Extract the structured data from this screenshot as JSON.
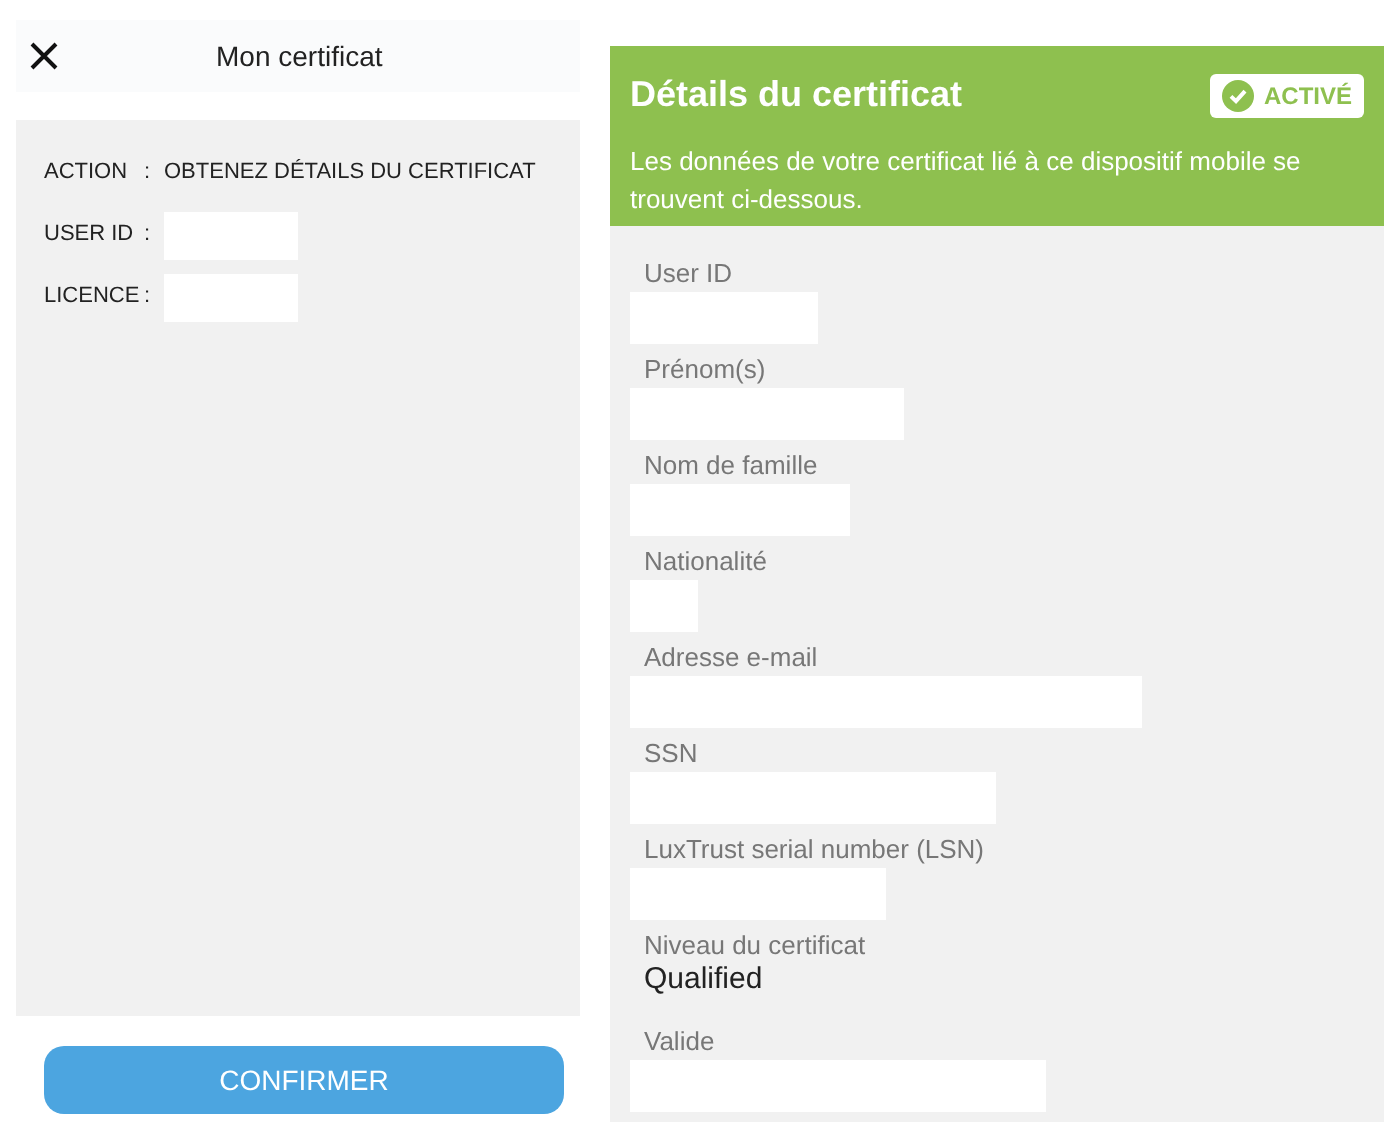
{
  "left_screen": {
    "title": "Mon certificat",
    "rows": [
      {
        "label": "ACTION",
        "separator": ":",
        "value": "OBTENEZ DÉTAILS DU CERTIFICAT"
      },
      {
        "label": "USER ID",
        "separator": ":"
      },
      {
        "label": "LICENCE",
        "separator": ":"
      }
    ],
    "button": "CONFIRMER"
  },
  "right_screen": {
    "banner": {
      "title": "Détails du certificat",
      "status": "ACTIVÉ",
      "description": "Les données de votre certificat lié à ce dispositif mobile se trouvent ci-dessous."
    },
    "fields": [
      {
        "label": "User ID"
      },
      {
        "label": "Prénom(s)"
      },
      {
        "label": "Nom de famille"
      },
      {
        "label": "Nationalité"
      },
      {
        "label": "Adresse e-mail"
      },
      {
        "label": "SSN"
      },
      {
        "label": "LuxTrust serial number (LSN)"
      },
      {
        "label": "Niveau du certificat",
        "value": "Qualified"
      },
      {
        "label": "Valide"
      }
    ]
  }
}
